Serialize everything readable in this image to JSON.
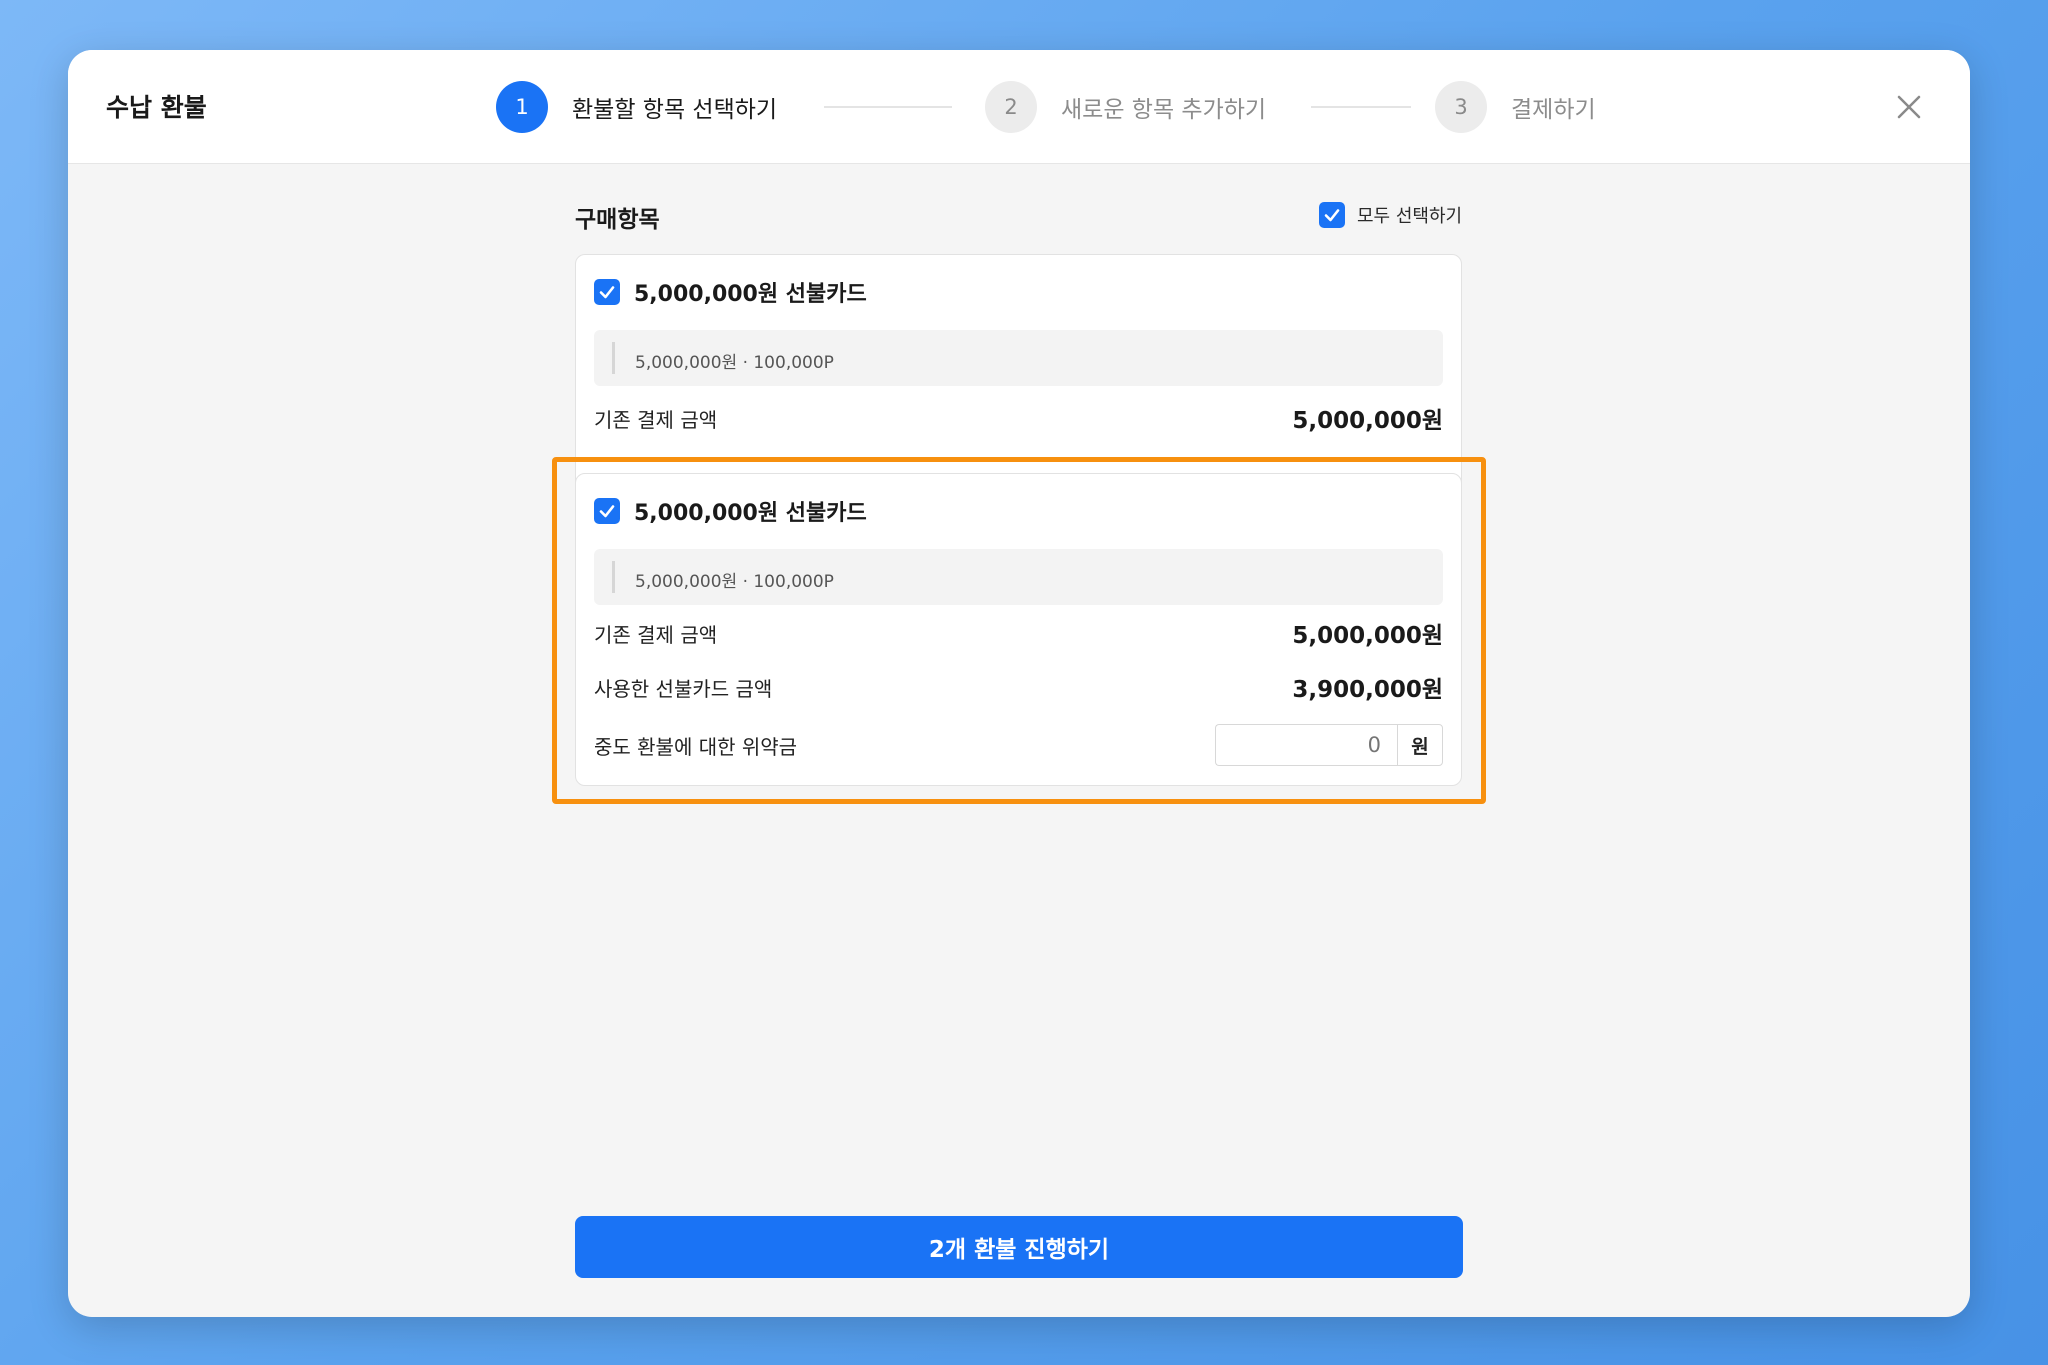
{
  "modal": {
    "title": "수납 환불",
    "steps": [
      {
        "num": "1",
        "label": "환불할 항목 선택하기",
        "active": true
      },
      {
        "num": "2",
        "label": "새로운 항목 추가하기",
        "active": false
      },
      {
        "num": "3",
        "label": "결제하기",
        "active": false
      }
    ],
    "close_icon": "close-icon"
  },
  "section": {
    "title": "구매항목",
    "select_all_label": "모두 선택하기",
    "select_all_checked": true
  },
  "items": [
    {
      "checked": true,
      "name": "5,000,000원 선불카드",
      "meta": "5,000,000원 · 100,000P",
      "original_label": "기존 결제 금액",
      "original_value": "5,000,000원"
    },
    {
      "checked": true,
      "name": "5,000,000원 선불카드",
      "meta": "5,000,000원 · 100,000P",
      "original_label": "기존 결제 금액",
      "original_value": "5,000,000원",
      "used_label": "사용한 선불카드 금액",
      "used_value": "3,900,000원",
      "penalty_label": "중도 환불에 대한 위약금",
      "penalty_placeholder": "0",
      "penalty_unit": "원"
    }
  ],
  "footer": {
    "submit_label": "2개 환불 진행하기"
  },
  "colors": {
    "accent": "#1a73f5",
    "highlight": "#f7900f"
  }
}
